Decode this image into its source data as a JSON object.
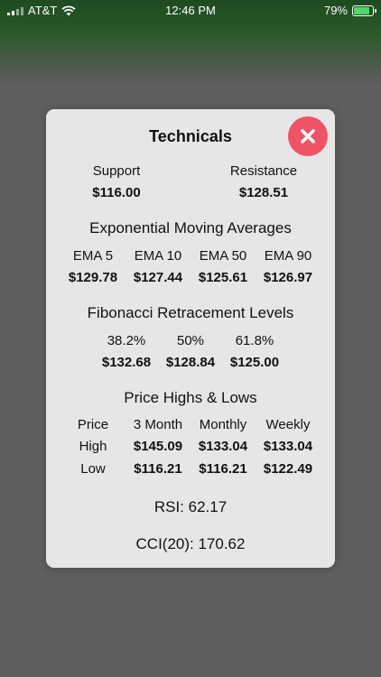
{
  "status": {
    "carrier": "AT&T",
    "time": "12:46 PM",
    "battery": "79%",
    "battery_level": 0.79
  },
  "modal": {
    "title": "Technicals",
    "support_label": "Support",
    "support_value": "$116.00",
    "resistance_label": "Resistance",
    "resistance_value": "$128.51",
    "ema": {
      "heading": "Exponential Moving Averages",
      "items": [
        {
          "label": "EMA 5",
          "value": "$129.78"
        },
        {
          "label": "EMA 10",
          "value": "$127.44"
        },
        {
          "label": "EMA 50",
          "value": "$125.61"
        },
        {
          "label": "EMA 90",
          "value": "$126.97"
        }
      ]
    },
    "fib": {
      "heading": "Fibonacci Retracement Levels",
      "items": [
        {
          "label": "38.2%",
          "value": "$132.68"
        },
        {
          "label": "50%",
          "value": "$128.84"
        },
        {
          "label": "61.8%",
          "value": "$125.00"
        }
      ]
    },
    "highs_lows": {
      "heading": "Price Highs & Lows",
      "columns": [
        "Price",
        "3 Month",
        "Monthly",
        "Weekly"
      ],
      "rows": [
        {
          "label": "High",
          "values": [
            "$145.09",
            "$133.04",
            "$133.04"
          ]
        },
        {
          "label": "Low",
          "values": [
            "$116.21",
            "$116.21",
            "$122.49"
          ]
        }
      ]
    },
    "rsi": "RSI: 62.17",
    "cci": "CCI(20): 170.62"
  }
}
